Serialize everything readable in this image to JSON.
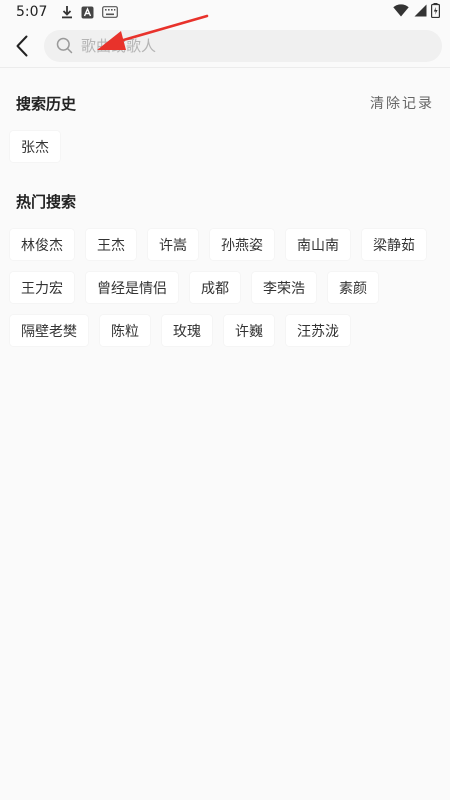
{
  "status_bar": {
    "time": "5:07"
  },
  "search": {
    "placeholder": "歌曲或歌人"
  },
  "history": {
    "title": "搜索历史",
    "clear_label": "清除记录",
    "items": [
      "张杰"
    ]
  },
  "hot": {
    "title": "热门搜索",
    "items": [
      "林俊杰",
      "王杰",
      "许嵩",
      "孙燕姿",
      "南山南",
      "梁静茹",
      "王力宏",
      "曾经是情侣",
      "成都",
      "李荣浩",
      "素颜",
      "隔壁老樊",
      "陈粒",
      "玫瑰",
      "许巍",
      "汪苏泷"
    ]
  },
  "colors": {
    "background": "#fafafa",
    "annotation_arrow": "#e8322b"
  }
}
